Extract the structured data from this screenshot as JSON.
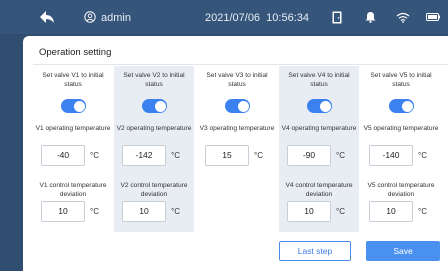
{
  "status_bar": {
    "user": "admin",
    "datetime": "2021/07/06  10:56:34",
    "icons": [
      "back-arrow-icon",
      "user-icon",
      "door-icon",
      "bell-icon",
      "wifi-icon",
      "battery-icon"
    ]
  },
  "panel": {
    "title": "Operation setting"
  },
  "columns": [
    {
      "valve_label": "Set valve V1 to initial status",
      "toggle_on": true,
      "temp_label": "V1 operating temperature",
      "temp_value": "-40",
      "temp_unit": "°C",
      "dev_label": "V1 control temperature deviation",
      "dev_value": "10",
      "dev_unit": "°C"
    },
    {
      "valve_label": "Set valve V2 to initial status",
      "toggle_on": true,
      "temp_label": "V2 operating temperature",
      "temp_value": "-142",
      "temp_unit": "°C",
      "dev_label": "V2 control temperature deviation",
      "dev_value": "10",
      "dev_unit": "°C"
    },
    {
      "valve_label": "Set valve V3 to initial status",
      "toggle_on": true,
      "temp_label": "V3 operating temperature",
      "temp_value": "15",
      "temp_unit": "°C"
    },
    {
      "valve_label": "Set valve V4 to initial status",
      "toggle_on": true,
      "temp_label": "V4 operating temperature",
      "temp_value": "-90",
      "temp_unit": "°C",
      "dev_label": "V4 control temperature deviation",
      "dev_value": "10",
      "dev_unit": "°C"
    },
    {
      "valve_label": "Set valve V5 to initial status",
      "toggle_on": true,
      "temp_label": "V5 operating temperature",
      "temp_value": "-140",
      "temp_unit": "°C",
      "dev_label": "V5 control temperature deviation",
      "dev_value": "10",
      "dev_unit": "°C"
    }
  ],
  "buttons": {
    "last_step": "Last step",
    "save": "Save"
  },
  "colors": {
    "accent": "#3b82f0",
    "header": "#35557a",
    "column_shade": "#e8edf3"
  }
}
